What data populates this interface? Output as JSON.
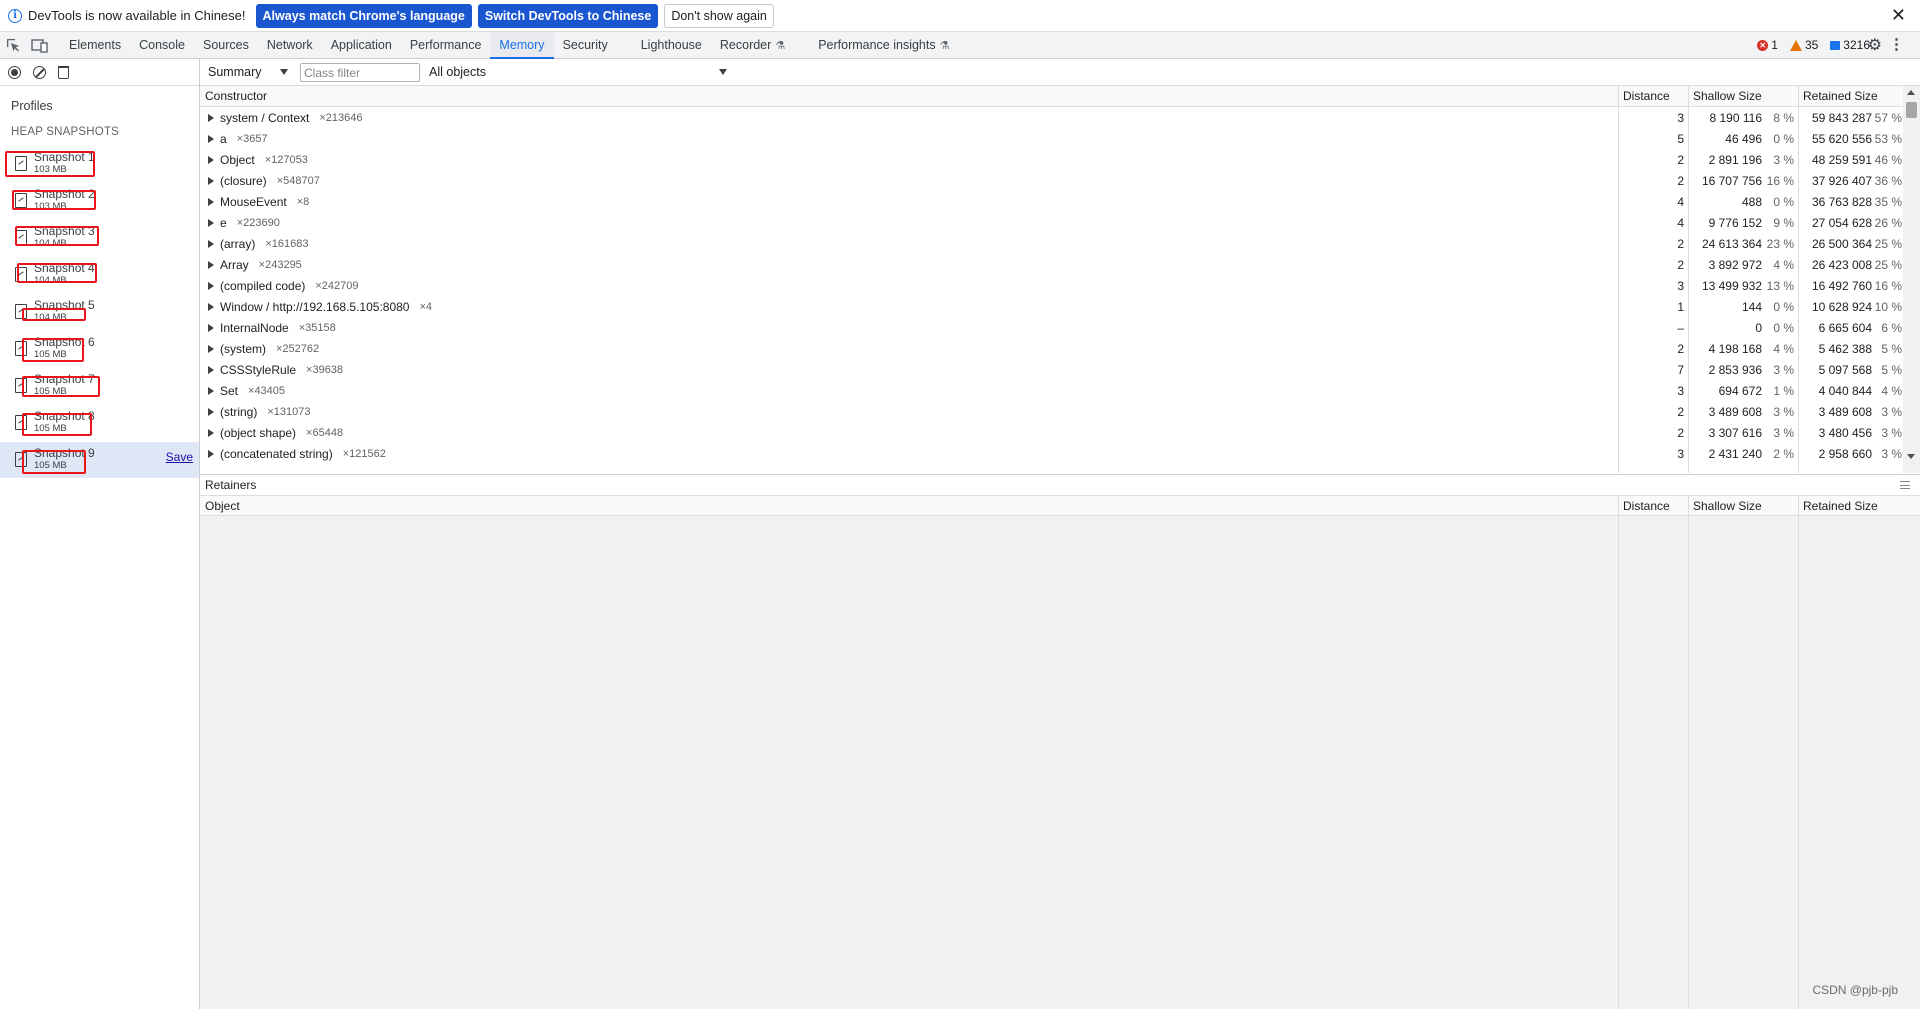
{
  "infobar": {
    "message": "DevTools is now available in Chinese!",
    "btn_match": "Always match Chrome's language",
    "btn_switch": "Switch DevTools to Chinese",
    "btn_dont_show": "Don't show again",
    "close_symbol": "✕"
  },
  "tabs": [
    {
      "label": "Elements"
    },
    {
      "label": "Console"
    },
    {
      "label": "Sources"
    },
    {
      "label": "Network"
    },
    {
      "label": "Application"
    },
    {
      "label": "Performance"
    },
    {
      "label": "Memory",
      "active": true
    },
    {
      "label": "Security"
    },
    {
      "label": "Lighthouse"
    },
    {
      "label": "Recorder",
      "experimental": true
    },
    {
      "label": "Performance insights",
      "experimental": true
    }
  ],
  "counters": {
    "errors": "1",
    "warnings": "35",
    "messages": "3216"
  },
  "sidebar": {
    "profiles_title": "Profiles",
    "section": "HEAP SNAPSHOTS",
    "save_label": "Save",
    "snapshots": [
      {
        "title": "Snapshot 1",
        "size": "103 MB"
      },
      {
        "title": "Snapshot 2",
        "size": "103 MB"
      },
      {
        "title": "Snapshot 3",
        "size": "104 MB"
      },
      {
        "title": "Snapshot 4",
        "size": "104 MB"
      },
      {
        "title": "Snapshot 5",
        "size": "104 MB"
      },
      {
        "title": "Snapshot 6",
        "size": "105 MB"
      },
      {
        "title": "Snapshot 7",
        "size": "105 MB"
      },
      {
        "title": "Snapshot 8",
        "size": "105 MB"
      },
      {
        "title": "Snapshot 9",
        "size": "105 MB",
        "selected": true
      }
    ]
  },
  "toolbar": {
    "view": "Summary",
    "class_filter_placeholder": "Class filter",
    "objects_filter": "All objects"
  },
  "grid": {
    "headers": {
      "constructor": "Constructor",
      "distance": "Distance",
      "shallow": "Shallow Size",
      "retained": "Retained Size"
    },
    "rows": [
      {
        "name": "system / Context",
        "count": "×213646",
        "distance": "3",
        "shallow": "8 190 116",
        "shallow_pct": "8 %",
        "retained": "59 843 287",
        "retained_pct": "57 %"
      },
      {
        "name": "a",
        "count": "×3657",
        "distance": "5",
        "shallow": "46 496",
        "shallow_pct": "0 %",
        "retained": "55 620 556",
        "retained_pct": "53 %"
      },
      {
        "name": "Object",
        "count": "×127053",
        "distance": "2",
        "shallow": "2 891 196",
        "shallow_pct": "3 %",
        "retained": "48 259 591",
        "retained_pct": "46 %"
      },
      {
        "name": "(closure)",
        "count": "×548707",
        "distance": "2",
        "shallow": "16 707 756",
        "shallow_pct": "16 %",
        "retained": "37 926 407",
        "retained_pct": "36 %"
      },
      {
        "name": "MouseEvent",
        "count": "×8",
        "distance": "4",
        "shallow": "488",
        "shallow_pct": "0 %",
        "retained": "36 763 828",
        "retained_pct": "35 %"
      },
      {
        "name": "e",
        "count": "×223690",
        "distance": "4",
        "shallow": "9 776 152",
        "shallow_pct": "9 %",
        "retained": "27 054 628",
        "retained_pct": "26 %"
      },
      {
        "name": "(array)",
        "count": "×161683",
        "distance": "2",
        "shallow": "24 613 364",
        "shallow_pct": "23 %",
        "retained": "26 500 364",
        "retained_pct": "25 %"
      },
      {
        "name": "Array",
        "count": "×243295",
        "distance": "2",
        "shallow": "3 892 972",
        "shallow_pct": "4 %",
        "retained": "26 423 008",
        "retained_pct": "25 %"
      },
      {
        "name": "(compiled code)",
        "count": "×242709",
        "distance": "3",
        "shallow": "13 499 932",
        "shallow_pct": "13 %",
        "retained": "16 492 760",
        "retained_pct": "16 %"
      },
      {
        "name": "Window / http://192.168.5.105:8080",
        "count": "×4",
        "distance": "1",
        "shallow": "144",
        "shallow_pct": "0 %",
        "retained": "10 628 924",
        "retained_pct": "10 %"
      },
      {
        "name": "InternalNode",
        "count": "×35158",
        "distance": "–",
        "shallow": "0",
        "shallow_pct": "0 %",
        "retained": "6 665 604",
        "retained_pct": "6 %"
      },
      {
        "name": "(system)",
        "count": "×252762",
        "distance": "2",
        "shallow": "4 198 168",
        "shallow_pct": "4 %",
        "retained": "5 462 388",
        "retained_pct": "5 %"
      },
      {
        "name": "CSSStyleRule",
        "count": "×39638",
        "distance": "7",
        "shallow": "2 853 936",
        "shallow_pct": "3 %",
        "retained": "5 097 568",
        "retained_pct": "5 %"
      },
      {
        "name": "Set",
        "count": "×43405",
        "distance": "3",
        "shallow": "694 672",
        "shallow_pct": "1 %",
        "retained": "4 040 844",
        "retained_pct": "4 %"
      },
      {
        "name": "(string)",
        "count": "×131073",
        "distance": "2",
        "shallow": "3 489 608",
        "shallow_pct": "3 %",
        "retained": "3 489 608",
        "retained_pct": "3 %"
      },
      {
        "name": "(object shape)",
        "count": "×65448",
        "distance": "2",
        "shallow": "3 307 616",
        "shallow_pct": "3 %",
        "retained": "3 480 456",
        "retained_pct": "3 %"
      },
      {
        "name": "(concatenated string)",
        "count": "×121562",
        "distance": "3",
        "shallow": "2 431 240",
        "shallow_pct": "2 %",
        "retained": "2 958 660",
        "retained_pct": "3 %"
      }
    ]
  },
  "retainers": {
    "title": "Retainers",
    "headers": {
      "object": "Object",
      "distance": "Distance",
      "shallow": "Shallow Size",
      "retained": "Retained Size"
    }
  },
  "watermark": "CSDN @pjb-pjb"
}
